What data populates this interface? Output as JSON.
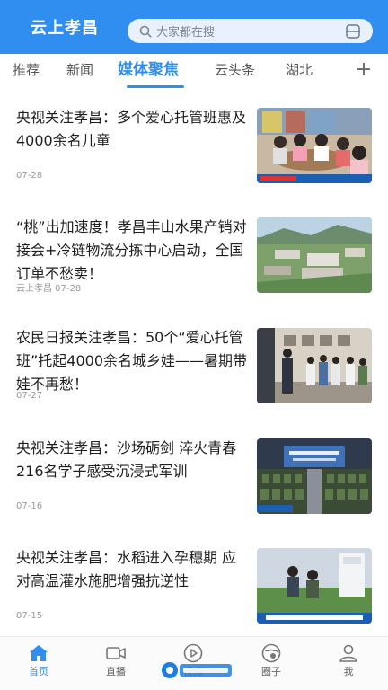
{
  "header": {
    "app_title": "云上孝昌",
    "search_placeholder": "大家都在搜"
  },
  "tabs": [
    {
      "label": "推荐"
    },
    {
      "label": "新闻"
    },
    {
      "label": "媒体聚焦"
    },
    {
      "label": "云头条"
    },
    {
      "label": "湖北"
    }
  ],
  "tab_add_label": "+",
  "news": [
    {
      "title": "央视关注孝昌：多个爱心托管班惠及4000余名儿童",
      "meta": "07-28"
    },
    {
      "title": "“桃”出加速度！孝昌丰山水果产销对接会+冷链物流分拣中心启动，全国订单不愁卖！",
      "meta": "云上孝昌  07-28"
    },
    {
      "title": "农民日报关注孝昌：50个“爱心托管班”托起4000余名城乡娃——暑期带娃不再愁！",
      "meta": "07-27"
    },
    {
      "title": "央视关注孝昌：沙场砺剑 淬火青春 216名学子感受沉浸式军训",
      "meta": "07-16"
    },
    {
      "title": "央视关注孝昌：水稻进入孕穗期 应对高温灌水施肥增强抗逆性",
      "meta": "07-15"
    }
  ],
  "bottom_nav": [
    {
      "label": "首页"
    },
    {
      "label": "直播"
    },
    {
      "label": "视频"
    },
    {
      "label": "圈子"
    },
    {
      "label": "我"
    }
  ],
  "colors": {
    "accent": "#2f8ef0"
  }
}
